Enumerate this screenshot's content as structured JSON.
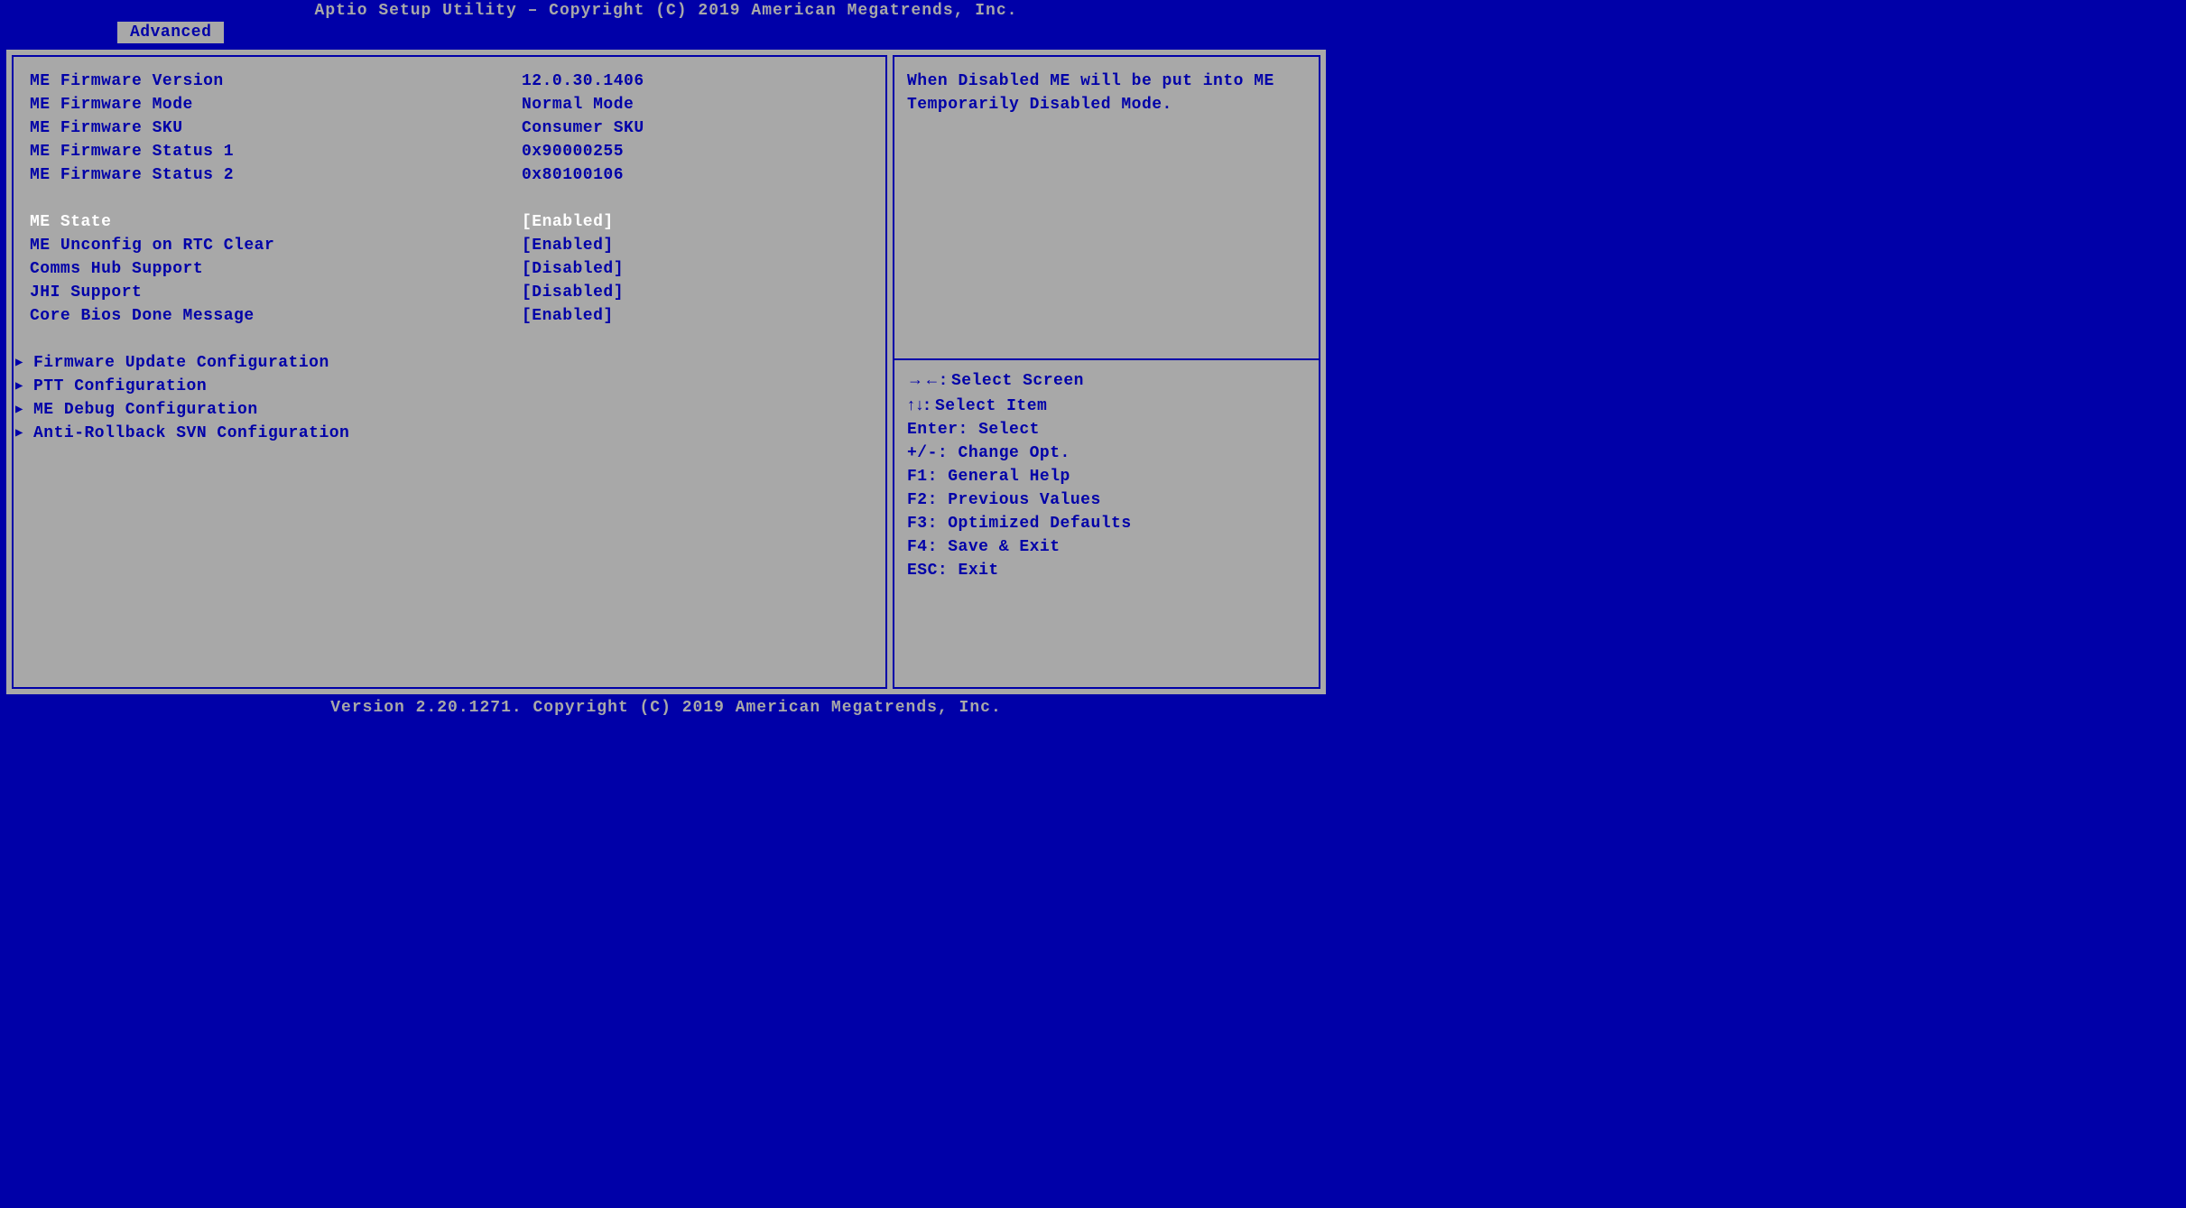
{
  "header": {
    "title": "Aptio Setup Utility – Copyright (C) 2019 American Megatrends, Inc."
  },
  "tab": {
    "label": "Advanced"
  },
  "info_items": [
    {
      "label": "ME Firmware Version",
      "value": "12.0.30.1406"
    },
    {
      "label": "ME Firmware Mode",
      "value": "Normal Mode"
    },
    {
      "label": "ME Firmware SKU",
      "value": "Consumer SKU"
    },
    {
      "label": "ME Firmware Status 1",
      "value": "0x90000255"
    },
    {
      "label": "ME Firmware Status 2",
      "value": "0x80100106"
    }
  ],
  "options": [
    {
      "label": "ME State",
      "value": "[Enabled]",
      "selected": true
    },
    {
      "label": "ME Unconfig on RTC Clear",
      "value": "[Enabled]",
      "selected": false
    },
    {
      "label": "Comms Hub Support",
      "value": "[Disabled]",
      "selected": false
    },
    {
      "label": "JHI Support",
      "value": "[Disabled]",
      "selected": false
    },
    {
      "label": "Core Bios Done Message",
      "value": "[Enabled]",
      "selected": false
    }
  ],
  "submenus": [
    {
      "label": "Firmware Update Configuration"
    },
    {
      "label": "PTT Configuration"
    },
    {
      "label": "ME Debug Configuration"
    },
    {
      "label": "Anti-Rollback SVN Configuration"
    }
  ],
  "help": {
    "text": "When Disabled ME will be put into ME Temporarily Disabled Mode."
  },
  "key_help": [
    {
      "keys": "→←:",
      "desc": "Select Screen",
      "arrows": true
    },
    {
      "keys": "↑↓:",
      "desc": "Select Item",
      "arrows": true
    },
    {
      "keys": "Enter:",
      "desc": "Select"
    },
    {
      "keys": "+/-:",
      "desc": "Change Opt."
    },
    {
      "keys": "F1:",
      "desc": "General Help"
    },
    {
      "keys": "F2:",
      "desc": "Previous Values"
    },
    {
      "keys": "F3:",
      "desc": "Optimized Defaults"
    },
    {
      "keys": "F4:",
      "desc": "Save & Exit"
    },
    {
      "keys": "ESC:",
      "desc": "Exit"
    }
  ],
  "footer": {
    "text": "Version 2.20.1271. Copyright (C) 2019 American Megatrends, Inc."
  }
}
